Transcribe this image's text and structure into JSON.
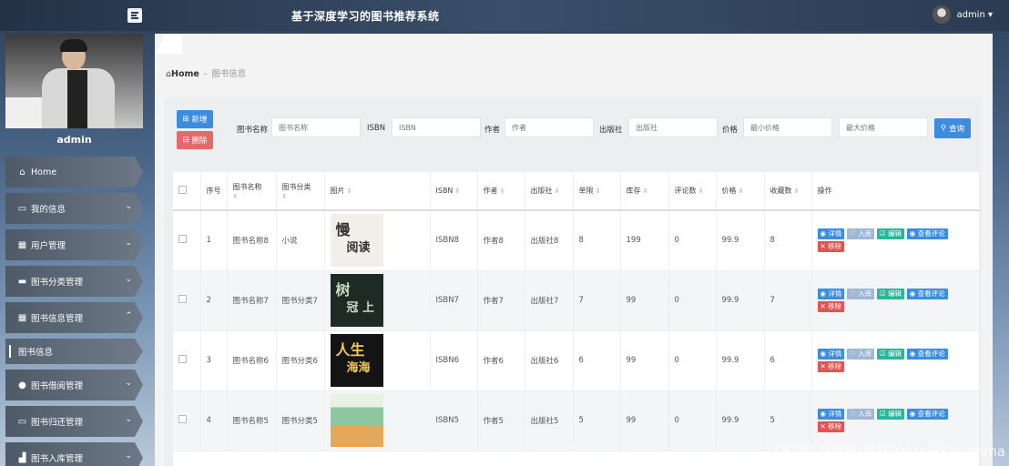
{
  "header": {
    "title": "基于深度学习的图书推荐系统",
    "user": "admin ▾"
  },
  "sidebar": {
    "username": "admin",
    "items": [
      {
        "label": "Home",
        "icon": "home-icon",
        "glyph": "⌂",
        "chevron": ""
      },
      {
        "label": "我的信息",
        "icon": "card-icon",
        "glyph": "▭",
        "chevron": "⌄"
      },
      {
        "label": "用户管理",
        "icon": "grid-icon",
        "glyph": "▦",
        "chevron": "⌄"
      },
      {
        "label": "图书分类管理",
        "icon": "briefcase-icon",
        "glyph": "▬",
        "chevron": "⌄"
      },
      {
        "label": "图书信息管理",
        "icon": "grid-icon",
        "glyph": "▦",
        "chevron": "⌃"
      },
      {
        "label": "图书信息",
        "icon": "",
        "glyph": "",
        "chevron": ""
      },
      {
        "label": "图书借阅管理",
        "icon": "user-icon",
        "glyph": "●",
        "chevron": "⌄"
      },
      {
        "label": "图书归还管理",
        "icon": "monitor-icon",
        "glyph": "▭",
        "chevron": "⌄"
      },
      {
        "label": "图书入库管理",
        "icon": "chart-icon",
        "glyph": "▟",
        "chevron": "⌄"
      }
    ]
  },
  "breadcrumb": {
    "home": "Home",
    "sep": "-",
    "current": "图书信息"
  },
  "toolbar": {
    "add_label": "新增",
    "delete_label": "删除",
    "search_label": "查询"
  },
  "filters": [
    {
      "label": "图书名称",
      "placeholder": "图书名称"
    },
    {
      "label": "ISBN",
      "placeholder": "ISBN"
    },
    {
      "label": "作者",
      "placeholder": "作者"
    },
    {
      "label": "出版社",
      "placeholder": "出版社"
    },
    {
      "label": "价格",
      "placeholder": "最小价格"
    },
    {
      "label": "",
      "placeholder": "最大价格"
    }
  ],
  "table": {
    "columns": [
      "",
      "序号",
      "图书名称",
      "图书分类",
      "图片",
      "ISBN",
      "作者",
      "出版社",
      "单限",
      "库存",
      "评论数",
      "价格",
      "收藏数",
      "操作"
    ],
    "rows": [
      {
        "no": "1",
        "name": "图书名称8",
        "cat": "小说",
        "isbn": "ISBN8",
        "author": "作者8",
        "pub": "出版社8",
        "limit": "8",
        "stock": "199",
        "reviews": "0",
        "price": "99.9",
        "fav": "8"
      },
      {
        "no": "2",
        "name": "图书名称7",
        "cat": "图书分类7",
        "isbn": "ISBN7",
        "author": "作者7",
        "pub": "出版社7",
        "limit": "7",
        "stock": "99",
        "reviews": "0",
        "price": "99.9",
        "fav": "7"
      },
      {
        "no": "3",
        "name": "图书名称6",
        "cat": "图书分类6",
        "isbn": "ISBN6",
        "author": "作者6",
        "pub": "出版社6",
        "limit": "6",
        "stock": "99",
        "reviews": "0",
        "price": "99.9",
        "fav": "6"
      },
      {
        "no": "4",
        "name": "图书名称5",
        "cat": "图书分类5",
        "isbn": "ISBN5",
        "author": "作者5",
        "pub": "出版社5",
        "limit": "5",
        "stock": "99",
        "reviews": "0",
        "price": "99.9",
        "fav": "5"
      }
    ],
    "actions": {
      "detail": "详情",
      "stock": "入库",
      "edit": "编辑",
      "review": "查看评论",
      "remove": "移除"
    }
  },
  "covers": [
    {
      "text1": "慢",
      "text2": "阅读",
      "bg": "#f1efe9",
      "fg": "#333"
    },
    {
      "text1": "树",
      "text2": "冠 上",
      "bg": "#1f2a24",
      "fg": "#c9d9c0"
    },
    {
      "text1": "人生",
      "text2": "海海",
      "bg": "#141414",
      "fg": "#f2c94c"
    },
    {
      "text1": "",
      "text2": "",
      "bg": "#8cc7a0",
      "fg": "#fff"
    }
  ],
  "watermark": "CSDN @枫叶(接毕设)vx:FY-yuanma"
}
